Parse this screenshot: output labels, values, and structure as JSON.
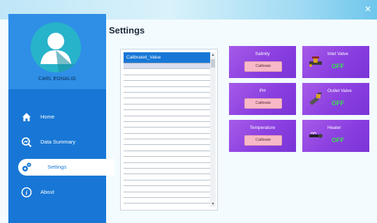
{
  "window": {
    "close_glyph": "✕"
  },
  "sidebar": {
    "user_name": "CARL EGNALIG",
    "items": [
      {
        "label": "Home",
        "icon": "home-icon"
      },
      {
        "label": "Data Summary",
        "icon": "data-summary-icon"
      },
      {
        "label": "Settings",
        "icon": "settings-icon",
        "active": true
      },
      {
        "label": "About",
        "icon": "info-icon"
      }
    ]
  },
  "main": {
    "title": "Settings",
    "list": {
      "selected_item": "Calibrated_Value",
      "up_arrow": "▲",
      "down_arrow": "▼"
    },
    "sensors": [
      {
        "title": "Salinity",
        "button": "Calibrate"
      },
      {
        "title": "PH",
        "button": "Calibrate"
      },
      {
        "title": "Temperature",
        "button": "Calibrate"
      }
    ],
    "devices": [
      {
        "title": "Inlet Valve",
        "status": "OFF"
      },
      {
        "title": "Outlet Valve",
        "status": "OFF"
      },
      {
        "title": "Heater",
        "status": "OFF"
      }
    ]
  },
  "colors": {
    "sidebar": "#1877d6",
    "card": "#8a3fe0",
    "status_off": "#39e34a",
    "calibrate_button": "#f7b9c7"
  }
}
